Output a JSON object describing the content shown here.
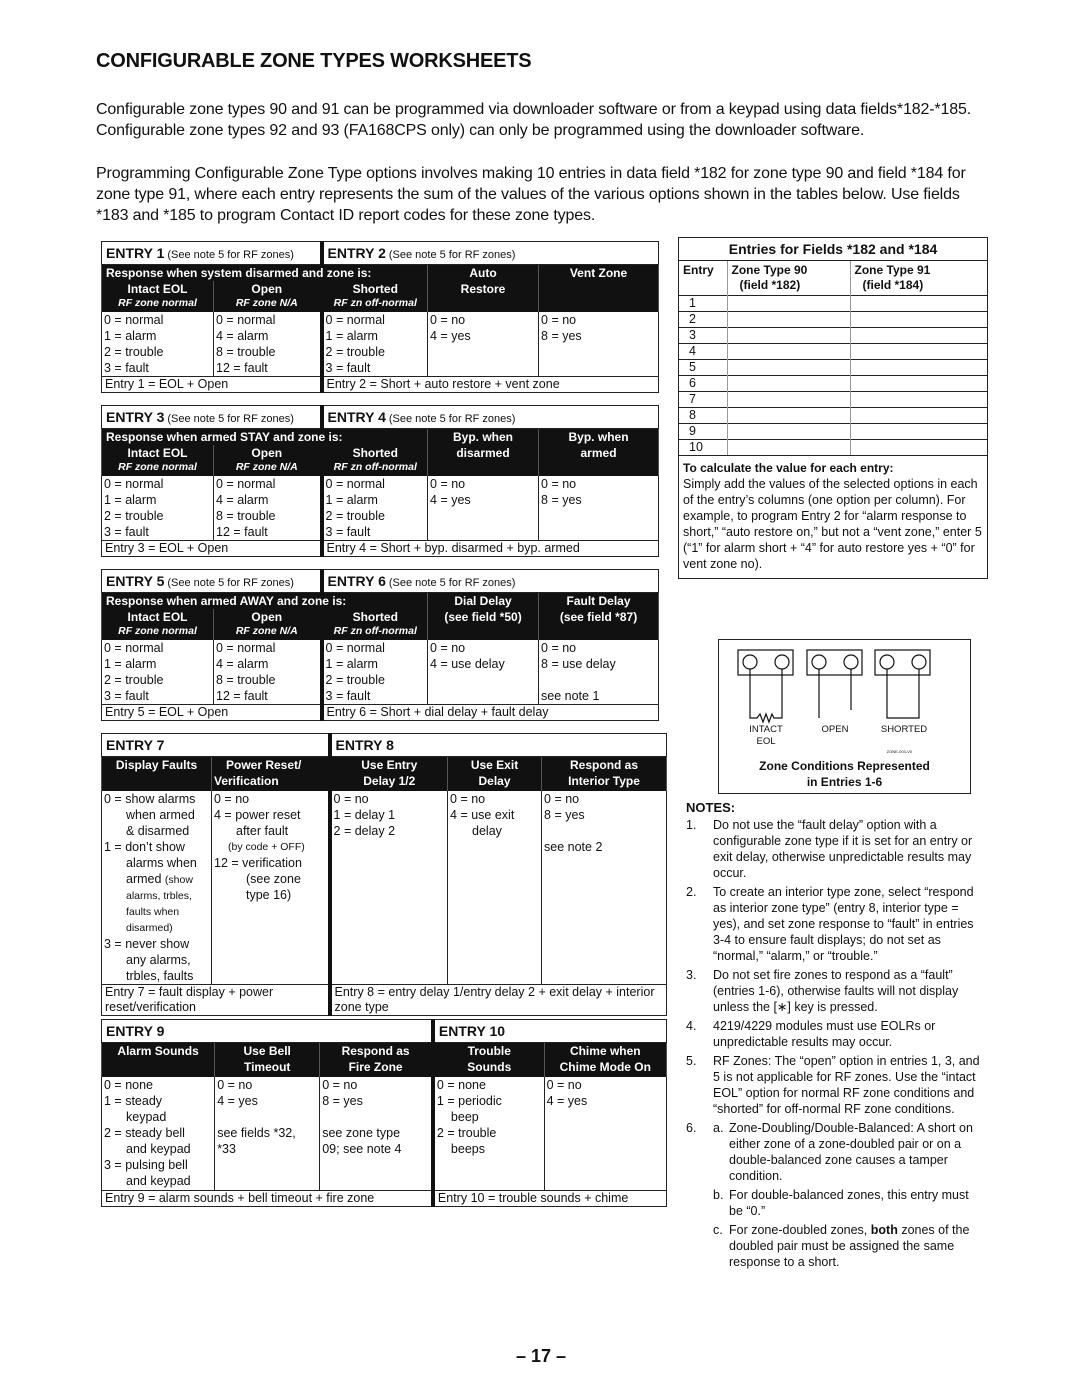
{
  "page": {
    "title": "CONFIGURABLE ZONE TYPES WORKSHEETS",
    "intro": [
      "Configurable zone types 90 and 91 can be programmed via downloader software or from a keypad using data fields*182-*185. Configurable zone types 92 and 93 (FA168CPS only) can only be programmed using the downloader software.",
      "Programming Configurable Zone Type options involves making 10 entries in data field *182 for zone type 90 and field *184 for zone type 91, where each entry represents the sum of the values of the various options shown in the tables below. Use fields *183 and *185 to program Contact ID report codes for these zone types."
    ],
    "page_number": "– 17 –"
  },
  "rf_note": "(See note 5 for RF zones)",
  "sub_labels": {
    "intact": "RF zone normal",
    "open": "RF zone N/A",
    "shorted": "RF zn off-normal"
  },
  "col_labels": {
    "intact": "Intact EOL",
    "open": "Open",
    "shorted": "Shorted"
  },
  "entries_1_2": {
    "left_title": "ENTRY 1",
    "right_title": "ENTRY 2",
    "response_header": "Response when system disarmed and zone is:",
    "col4": [
      "Auto",
      "Restore"
    ],
    "col5": "Vent Zone",
    "intact": [
      "0 = normal",
      "1 = alarm",
      "2 = trouble",
      "3 = fault"
    ],
    "open": [
      "0 = normal",
      "4 = alarm",
      "8 = trouble",
      "12 = fault"
    ],
    "shorted": [
      "0 = normal",
      "1 = alarm",
      "2 = trouble",
      "3 = fault"
    ],
    "col4_opts": [
      "0 = no",
      "4 = yes"
    ],
    "col5_opts": [
      "0 = no",
      "8 = yes"
    ],
    "col5_note": "",
    "left_formula": "Entry 1 = EOL + Open",
    "right_formula": "Entry 2 = Short + auto restore + vent zone"
  },
  "entries_3_4": {
    "left_title": "ENTRY 3",
    "right_title": "ENTRY 4",
    "response_header": "Response when armed STAY and zone is:",
    "col4": [
      "Byp. when",
      "disarmed"
    ],
    "col5": [
      "Byp. when",
      "armed"
    ],
    "intact": [
      "0 = normal",
      "1 = alarm",
      "2 = trouble",
      "3 = fault"
    ],
    "open": [
      "0 = normal",
      "4 = alarm",
      "8 = trouble",
      "12 = fault"
    ],
    "shorted": [
      "0 = normal",
      "1 = alarm",
      "2 = trouble",
      "3 = fault"
    ],
    "col4_opts": [
      "0 = no",
      "4 = yes"
    ],
    "col5_opts": [
      "0 = no",
      "8 = yes"
    ],
    "col5_note": "",
    "left_formula": "Entry 3 = EOL + Open",
    "right_formula": "Entry 4 = Short + byp. disarmed + byp. armed"
  },
  "entries_5_6": {
    "left_title": "ENTRY 5",
    "right_title": "ENTRY 6",
    "response_header": "Response when armed AWAY and zone is:",
    "col4": [
      "Dial Delay",
      "(see field *50)"
    ],
    "col5": [
      "Fault Delay",
      "(see field *87)"
    ],
    "intact": [
      "0 = normal",
      "1 = alarm",
      "2 = trouble",
      "3 = fault"
    ],
    "open": [
      "0 = normal",
      "4 = alarm",
      "8 = trouble",
      "12 = fault"
    ],
    "shorted": [
      "0 = normal",
      "1 = alarm",
      "2 = trouble",
      "3 = fault"
    ],
    "col4_opts": [
      "0 = no",
      "4 = use delay"
    ],
    "col5_opts": [
      "0 = no",
      "8 = use delay"
    ],
    "col5_note": "see note 1",
    "left_formula": "Entry 5 = EOL + Open",
    "right_formula": "Entry 6 = Short + dial delay + fault delay"
  },
  "entries_7_8": {
    "left_title": "ENTRY 7",
    "right_title": "ENTRY 8",
    "headers": [
      [
        "Display Faults",
        ""
      ],
      [
        "Power Reset/",
        "Verification"
      ],
      [
        "Use Entry",
        "Delay 1/2"
      ],
      [
        "Use Exit",
        "Delay"
      ],
      [
        "Respond as",
        "Interior Type"
      ]
    ],
    "display_faults": {
      "o0": "0 = show alarms",
      "o0b": "when armed",
      "o0c": "& disarmed",
      "o1": "1 = don’t show",
      "o1b": "alarms when",
      "o1c": "armed",
      "o1c_small": "(show",
      "o1d": "alarms, trbles,",
      "o1e": "faults when",
      "o1f": "disarmed)",
      "o3": "3 = never show",
      "o3b": "any alarms,",
      "o3c": "trbles, faults"
    },
    "power_reset": {
      "o0": "0 = no",
      "o4": "4 = power reset",
      "o4b": "after fault",
      "o4c": "(by code + OFF)",
      "o12": "12 = verification",
      "o12b": "(see zone",
      "o12c": "type 16)"
    },
    "entry_delay": [
      "0 = no",
      "1 = delay 1",
      "2 = delay 2"
    ],
    "exit_delay": {
      "o0": "0 = no",
      "o4": "4 = use exit",
      "o4b": "delay"
    },
    "interior": [
      "0 = no",
      "8 = yes"
    ],
    "interior_note": "see note 2",
    "left_formula": "Entry 7 = fault display + power reset/verification",
    "right_formula": "Entry 8 = entry delay 1/entry delay 2 + exit delay + interior zone type"
  },
  "entries_9_10": {
    "left_title": "ENTRY 9",
    "right_title": "ENTRY 10",
    "headers": [
      [
        "Alarm Sounds",
        ""
      ],
      [
        "Use Bell",
        "Timeout"
      ],
      [
        "Respond as",
        "Fire Zone"
      ],
      [
        "Trouble",
        "Sounds"
      ],
      [
        "Chime when",
        "Chime Mode On"
      ]
    ],
    "alarm_sounds": {
      "o0": "0 = none",
      "o1": "1 = steady",
      "o1b": "keypad",
      "o2": "2 = steady bell",
      "o2b": "and keypad",
      "o3": "3 = pulsing bell",
      "o3b": "and keypad"
    },
    "bell_timeout": {
      "o0": "0 = no",
      "o4": "4 = yes",
      "note": "see fields *32,",
      "note_b": "*33"
    },
    "fire_zone": {
      "o0": "0 = no",
      "o8": "8 = yes",
      "note": "see zone type",
      "note_b": "09; see note 4"
    },
    "trouble_sounds": {
      "o0": "0 = none",
      "o1": "1 = periodic",
      "o1b": "beep",
      "o2": "2 = trouble",
      "o2b": "beeps"
    },
    "chime": [
      "0 = no",
      "4 = yes"
    ],
    "left_formula": "Entry 9 = alarm sounds + bell timeout + fire zone",
    "right_formula": "Entry 10 = trouble sounds + chime"
  },
  "fields_table": {
    "title": "Entries for Fields *182 and *184",
    "headers": [
      "Entry",
      "Zone Type 90",
      "(field *182)",
      "Zone Type 91",
      "(field *184)"
    ],
    "rows": [
      "1",
      "2",
      "3",
      "4",
      "5",
      "6",
      "7",
      "8",
      "9",
      "10"
    ],
    "calc_title": "To calculate the value for each entry:",
    "calc_text": "Simply add the values of the selected options in each of the entry’s columns (one option per column). For example, to program Entry 2 for “alarm response to short,” “auto restore on,” but not a “vent zone,” enter 5 (“1” for alarm short + “4” for auto restore yes + “0” for vent zone no)."
  },
  "diagram": {
    "labels": [
      "INTACT",
      "EOL",
      "OPEN",
      "SHORTED"
    ],
    "code": "ZONE-003-V0",
    "caption": [
      "Zone Conditions Represented",
      "in Entries 1-6"
    ]
  },
  "notes": {
    "title": "NOTES:",
    "items": [
      {
        "num": "1.",
        "text": "Do not use the “fault delay” option with a configurable zone type if it is set for an entry or exit delay, otherwise unpredictable results may occur."
      },
      {
        "num": "2.",
        "text": "To create an interior type zone, select “respond as interior zone type” (entry 8, interior type = yes), and set zone response to “fault” in entries 3-4 to ensure fault displays; do not set as “normal,” “alarm,” or “trouble.”"
      },
      {
        "num": "3.",
        "text": "Do not set fire zones to respond as a “fault” (entries 1-6), otherwise faults will not display unless the [∗] key is pressed."
      },
      {
        "num": "4.",
        "text": "4219/4229 modules must use EOLRs or unpredictable results may occur."
      },
      {
        "num": "5.",
        "text": "RF Zones: The “open” option in entries 1, 3, and 5 is not applicable for RF zones. Use the “intact EOL” option for normal RF zone conditions and “shorted” for off-normal RF zone conditions."
      }
    ],
    "note6": {
      "num": "6.",
      "a": {
        "num": "a.",
        "text": "Zone-Doubling/Double-Balanced: A short on either zone of a zone-doubled pair or on a double-balanced zone causes a tamper condition."
      },
      "b": {
        "num": "b.",
        "text": "For double-balanced zones, this entry must be “0.”"
      },
      "c": {
        "num": "c.",
        "pre": "For zone-doubled zones, ",
        "bold": "both",
        "post": " zones of the doubled pair must be assigned the same response to a short."
      }
    }
  }
}
